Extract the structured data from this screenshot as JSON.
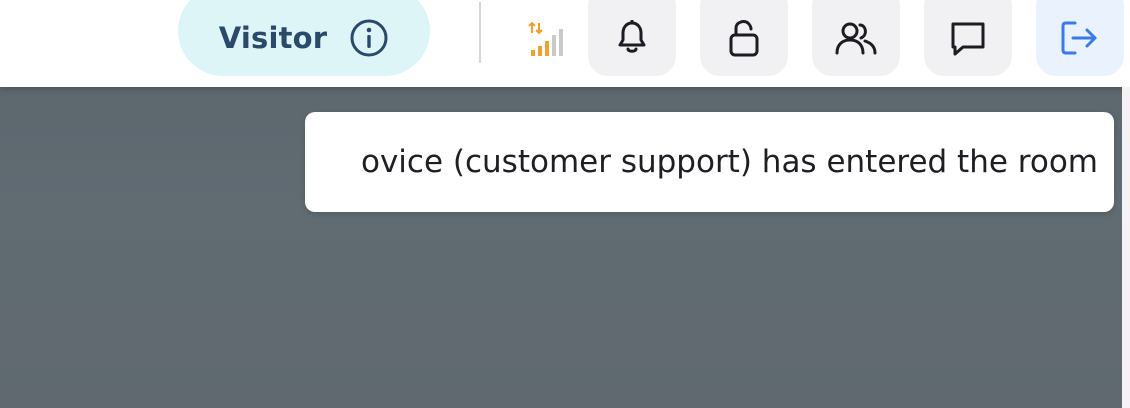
{
  "header": {
    "role_label": "Visitor",
    "icons": {
      "info": "info-circle-icon",
      "signal": "network-signal-icon",
      "notifications": "bell-icon",
      "lock": "unlocked-padlock-icon",
      "users": "users-icon",
      "chat": "chat-bubble-icon",
      "exit": "logout-icon"
    }
  },
  "notification": {
    "message": "ovice (customer support) has entered the room"
  },
  "colors": {
    "role_pill_bg": "#def5f7",
    "role_text": "#2b4a6b",
    "exit_accent": "#3b7be8",
    "signal_active": "#f0a12b",
    "signal_inactive": "#c9c9c9",
    "canvas_bg": "#5e686f"
  }
}
